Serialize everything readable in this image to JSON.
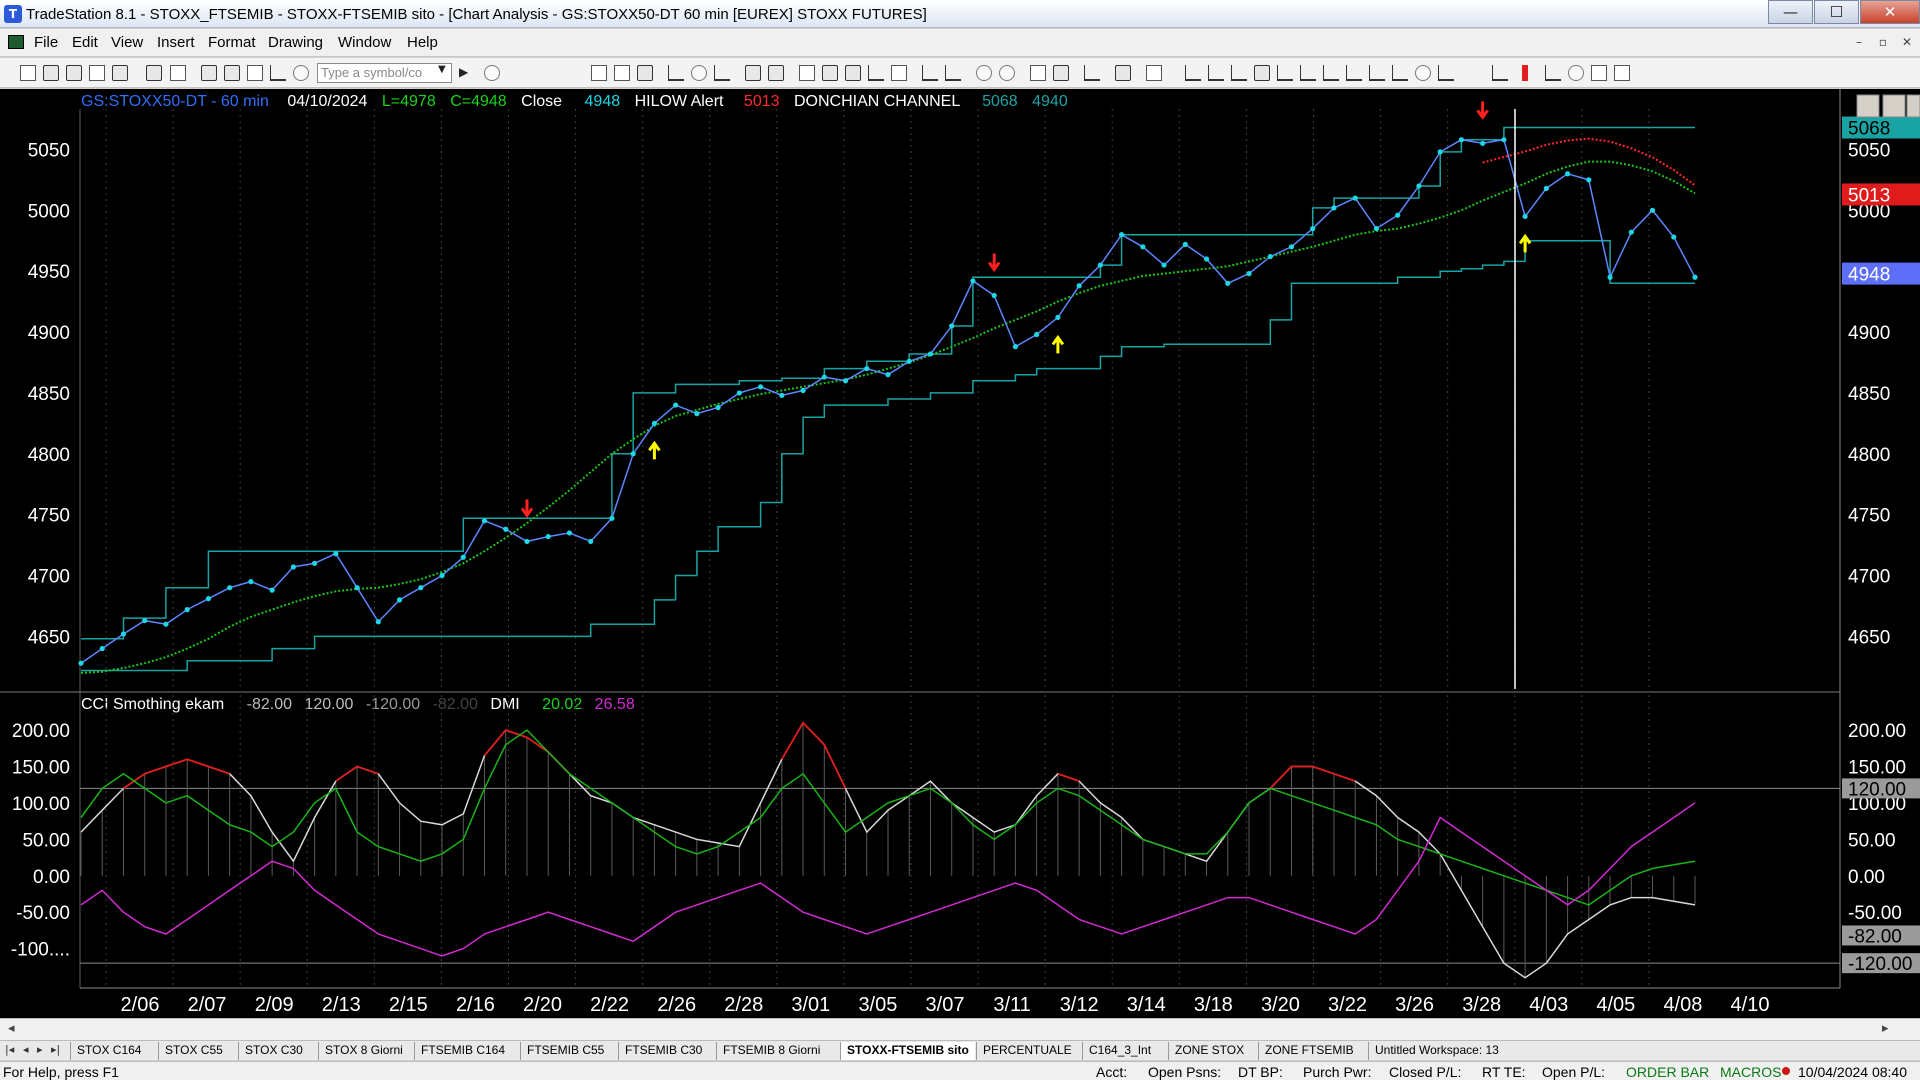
{
  "window": {
    "title": "TradeStation 8.1 - STOXX_FTSEMIB - STOXX-FTSEMIB sito - [Chart Analysis - GS:STOXX50-DT  60 min  [EUREX] STOXX FUTURES]",
    "min": "—",
    "max": "☐",
    "close": "✕"
  },
  "menu": [
    "File",
    "Edit",
    "View",
    "Insert",
    "Format",
    "Drawing",
    "Window",
    "Help"
  ],
  "mdi": [
    "–",
    "▫",
    "✕"
  ],
  "toolbar": {
    "symbol_placeholder": "Type a symbol/co",
    "drop": "▼",
    "go": "▶"
  },
  "price_legend": {
    "symbol": "GS:STOXX50-DT - 60 min",
    "date": "04/10/2024",
    "low": "L=4978",
    "close": "C=4948",
    "close_label": "Close",
    "close_value": "4948",
    "indicator": "HILOW Alert",
    "alert_value": "5013",
    "channel": "DONCHIAN CHANNEL",
    "upper": "5068",
    "lower": "4940"
  },
  "price_markers": [
    "5068",
    "5013",
    "4948"
  ],
  "osc_legend": {
    "name": "CCI Smothing ekam",
    "v1": "-82.00",
    "v2": "120.00",
    "v3": "-120.00",
    "v4": "-82.00",
    "dmi": "DMI",
    "dmi_plus": "20.02",
    "dmi_minus": "26.58"
  },
  "osc_markers": [
    "120.00",
    "-82.00",
    "-120.00"
  ],
  "tabs": [
    "STOX C164",
    "STOX C55",
    "STOX  C30",
    "STOX  8 Giorni",
    "FTSEMIB C164",
    "FTSEMIB C55",
    "FTSEMIB C30",
    "FTSEMIB  8 Giorni",
    "STOXX-FTSEMIB sito",
    "PERCENTUALE",
    "C164_3_Int",
    "ZONE STOX",
    "ZONE FTSEMIB",
    "Untitled Workspace:  13"
  ],
  "active_tab": "STOXX-FTSEMIB sito",
  "status": {
    "help": "For Help, press F1",
    "acct": "Acct:",
    "open_psns": "Open Psns:",
    "dt_bp": "DT BP:",
    "purch_pwr": "Purch Pwr:",
    "closed_pl": "Closed P/L:",
    "rt_te": "RT TE:",
    "open_pl": "Open P/L:",
    "order_bar": "ORDER BAR",
    "macros": "MACROS",
    "datetime": "10/04/2024 08:40"
  },
  "colors": {
    "price": "#1ed7e6",
    "ema": "#19c619",
    "donchian": "#1aa3a3",
    "alert_up": "#ffff00",
    "alert_down": "#ff2020",
    "hilow": "#ff2a2a",
    "cci": "#d8d8d8",
    "dmi_plus": "#18b418",
    "dmi_minus": "#d22ad2",
    "cci_hot": "#e01b1b"
  },
  "chart_data": {
    "type": "line",
    "title": "GS:STOXX50-DT - 60 min",
    "x_tick_labels": [
      "2/06",
      "2/07",
      "2/09",
      "2/13",
      "2/15",
      "2/16",
      "2/20",
      "2/22",
      "2/26",
      "2/28",
      "3/01",
      "3/05",
      "3/07",
      "3/11",
      "3/12",
      "3/14",
      "3/18",
      "3/20",
      "3/22",
      "3/26",
      "3/28",
      "4/03",
      "4/05",
      "4/08",
      "4/10"
    ],
    "price_panel": {
      "ylim": [
        4615,
        5075
      ],
      "yticks": [
        4650,
        4700,
        4750,
        4800,
        4850,
        4900,
        4950,
        5000,
        5050
      ],
      "series": [
        {
          "name": "Close",
          "values": [
            4628,
            4640,
            4652,
            4663,
            4660,
            4672,
            4681,
            4690,
            4695,
            4688,
            4707,
            4710,
            4718,
            4690,
            4662,
            4680,
            4690,
            4700,
            4715,
            4745,
            4738,
            4728,
            4732,
            4735,
            4728,
            4747,
            4800,
            4825,
            4840,
            4833,
            4838,
            4850,
            4855,
            4848,
            4852,
            4863,
            4860,
            4870,
            4865,
            4876,
            4882,
            4905,
            4942,
            4930,
            4888,
            4898,
            4912,
            4938,
            4955,
            4980,
            4970,
            4955,
            4972,
            4960,
            4940,
            4948,
            4962,
            4970,
            4985,
            5002,
            5010,
            4985,
            4996,
            5020,
            5048,
            5058,
            5055,
            5058,
            4995,
            5018,
            5030,
            5025,
            4945,
            4982,
            5000,
            4978,
            4945
          ]
        },
        {
          "name": "EMA",
          "values": [
            4620,
            4621,
            4624,
            4628,
            4633,
            4640,
            4648,
            4658,
            4666,
            4672,
            4678,
            4683,
            4687,
            4689,
            4690,
            4693,
            4697,
            4703,
            4710,
            4720,
            4731,
            4743,
            4756,
            4770,
            4785,
            4800,
            4812,
            4823,
            4831,
            4836,
            4841,
            4845,
            4849,
            4852,
            4855,
            4858,
            4861,
            4865,
            4870,
            4875,
            4881,
            4888,
            4895,
            4903,
            4910,
            4917,
            4925,
            4932,
            4938,
            4942,
            4946,
            4948,
            4950,
            4952,
            4954,
            4958,
            4962,
            4966,
            4970,
            4975,
            4980,
            4983,
            4985,
            4989,
            4994,
            5000,
            5008,
            5015,
            5022,
            5030,
            5036,
            5040,
            5040,
            5037,
            5032,
            5024,
            5014
          ]
        },
        {
          "name": "Donchian Upper",
          "values": [
            4648,
            4648,
            4665,
            4665,
            4690,
            4690,
            4720,
            4720,
            4720,
            4720,
            4720,
            4720,
            4720,
            4720,
            4720,
            4720,
            4720,
            4720,
            4747,
            4747,
            4747,
            4747,
            4747,
            4747,
            4747,
            4800,
            4850,
            4850,
            4857,
            4857,
            4857,
            4860,
            4860,
            4862,
            4862,
            4870,
            4870,
            4876,
            4876,
            4882,
            4882,
            4905,
            4945,
            4945,
            4945,
            4945,
            4945,
            4945,
            4955,
            4980,
            4980,
            4980,
            4980,
            4980,
            4980,
            4980,
            4980,
            4980,
            5002,
            5010,
            5010,
            5010,
            5010,
            5020,
            5048,
            5058,
            5058,
            5068,
            5068,
            5068,
            5068,
            5068,
            5068,
            5068,
            5068,
            5068,
            5068
          ]
        },
        {
          "name": "Donchian Lower",
          "values": [
            4622,
            4622,
            4622,
            4622,
            4622,
            4630,
            4630,
            4630,
            4630,
            4640,
            4640,
            4650,
            4650,
            4650,
            4650,
            4650,
            4650,
            4650,
            4650,
            4650,
            4650,
            4650,
            4650,
            4650,
            4660,
            4660,
            4660,
            4680,
            4700,
            4720,
            4740,
            4740,
            4760,
            4800,
            4830,
            4840,
            4840,
            4840,
            4845,
            4845,
            4850,
            4850,
            4860,
            4860,
            4865,
            4870,
            4870,
            4870,
            4880,
            4888,
            4888,
            4890,
            4890,
            4890,
            4890,
            4890,
            4910,
            4940,
            4940,
            4940,
            4940,
            4940,
            4945,
            4945,
            4950,
            4952,
            4955,
            4958,
            4975,
            4975,
            4975,
            4975,
            4940,
            4940,
            4940,
            4940,
            4940
          ]
        }
      ]
    },
    "osc_panel": {
      "ylim": [
        -150,
        240
      ],
      "yticks": [
        200,
        150,
        100,
        50,
        0,
        -50,
        -100
      ],
      "ytick_labels": [
        "200.00",
        "150.00",
        "100.00",
        "50.00",
        "0.00",
        "-50.00",
        "-100...."
      ],
      "hlines": [
        120,
        -120
      ],
      "series": [
        {
          "name": "CCI",
          "values": [
            60,
            90,
            120,
            140,
            150,
            160,
            150,
            140,
            110,
            60,
            20,
            80,
            130,
            150,
            140,
            100,
            75,
            70,
            85,
            165,
            200,
            190,
            170,
            140,
            110,
            100,
            80,
            70,
            60,
            50,
            45,
            40,
            100,
            160,
            210,
            180,
            120,
            60,
            90,
            110,
            130,
            100,
            80,
            60,
            70,
            110,
            140,
            130,
            100,
            80,
            50,
            40,
            30,
            20,
            60,
            100,
            120,
            150,
            150,
            140,
            130,
            110,
            80,
            60,
            30,
            -20,
            -70,
            -120,
            -140,
            -120,
            -80,
            -60,
            -40,
            -30,
            -30,
            -35,
            -40
          ]
        },
        {
          "name": "DMI+",
          "values": [
            80,
            120,
            140,
            120,
            100,
            110,
            90,
            70,
            60,
            40,
            60,
            100,
            120,
            60,
            40,
            30,
            20,
            30,
            50,
            120,
            180,
            200,
            170,
            140,
            120,
            100,
            80,
            60,
            40,
            30,
            40,
            60,
            80,
            120,
            140,
            100,
            60,
            80,
            100,
            110,
            120,
            100,
            70,
            50,
            70,
            100,
            120,
            110,
            90,
            70,
            50,
            40,
            30,
            30,
            60,
            100,
            120,
            110,
            100,
            90,
            80,
            70,
            50,
            40,
            30,
            20,
            10,
            0,
            -10,
            -20,
            -30,
            -40,
            -20,
            0,
            10,
            15,
            20
          ]
        },
        {
          "name": "DMI-",
          "values": [
            -40,
            -20,
            -50,
            -70,
            -80,
            -60,
            -40,
            -20,
            0,
            20,
            10,
            -20,
            -40,
            -60,
            -80,
            -90,
            -100,
            -110,
            -100,
            -80,
            -70,
            -60,
            -50,
            -60,
            -70,
            -80,
            -90,
            -70,
            -50,
            -40,
            -30,
            -20,
            -10,
            -30,
            -50,
            -60,
            -70,
            -80,
            -70,
            -60,
            -50,
            -40,
            -30,
            -20,
            -10,
            -20,
            -40,
            -60,
            -70,
            -80,
            -70,
            -60,
            -50,
            -40,
            -30,
            -30,
            -40,
            -50,
            -60,
            -70,
            -80,
            -60,
            -20,
            20,
            80,
            60,
            40,
            20,
            0,
            -20,
            -40,
            -20,
            10,
            40,
            60,
            80,
            100
          ]
        }
      ]
    },
    "alerts": [
      {
        "type": "down",
        "x_index": 21
      },
      {
        "type": "up",
        "x_index": 27
      },
      {
        "type": "down",
        "x_index": 43
      },
      {
        "type": "up",
        "x_index": 46
      },
      {
        "type": "down",
        "x_index": 66
      },
      {
        "type": "up",
        "x_index": 68
      }
    ]
  }
}
